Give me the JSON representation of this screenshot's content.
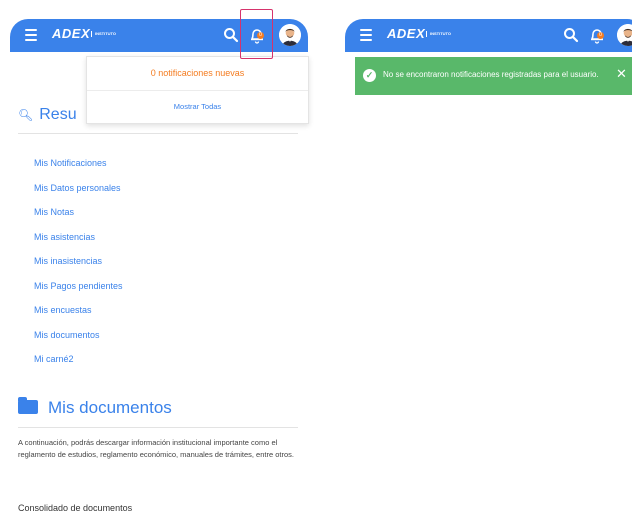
{
  "header": {
    "brand": "ADEX",
    "brand_sub": "INSTITUTO",
    "notification_count": "0"
  },
  "notifications_dropdown": {
    "title": "0 notificaciones nuevas",
    "show_all": "Mostrar Todas"
  },
  "summary": {
    "title": "Resu"
  },
  "menu": {
    "items": [
      "Mis Notificaciones",
      "Mis Datos personales",
      "Mis Notas",
      "Mis asistencias",
      "Mis inasistencias",
      "Mis Pagos pendientes",
      "Mis encuestas",
      "Mis documentos",
      "Mi carné2"
    ]
  },
  "documents": {
    "title": "Mis documentos",
    "description": "A continuación, podrás descargar información institucional importante como el reglamento de estudios, reglamento económico, manuales de trámites, entre otros.",
    "consolidated": "Consolidado de documentos"
  },
  "alert": {
    "message": "No se encontraron notificaciones registradas para el usuario."
  },
  "colors": {
    "primary": "#3a82ea",
    "accent": "#f47c20",
    "success": "#59b86a",
    "highlight": "#d6336c"
  },
  "icons": {
    "menu": "hamburger-menu-icon",
    "search": "search-icon",
    "bell": "bell-icon",
    "avatar": "user-avatar",
    "magnifier": "magnifier-icon",
    "folder": "folder-icon",
    "check": "check-circle-icon",
    "close": "close-icon"
  }
}
